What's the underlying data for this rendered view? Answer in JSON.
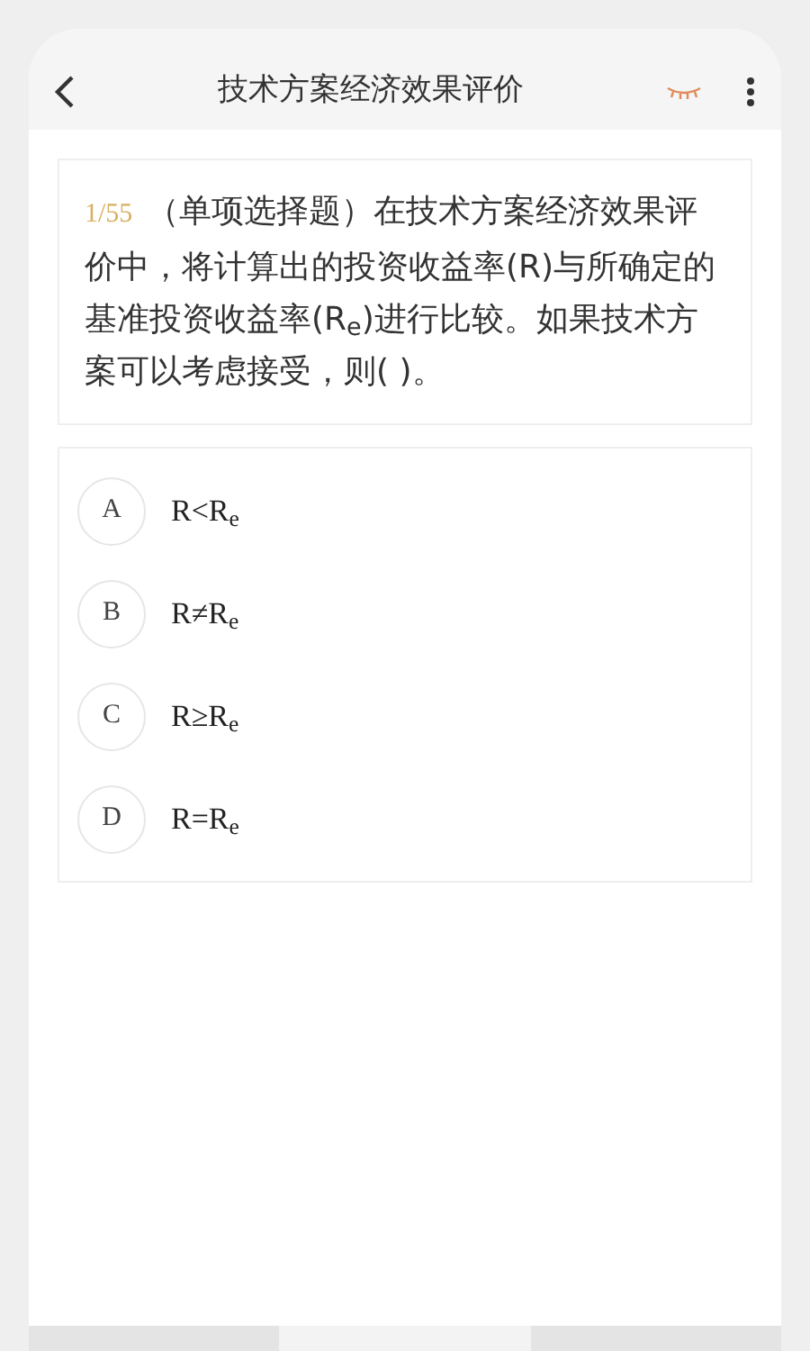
{
  "header": {
    "title": "技术方案经济效果评价"
  },
  "question": {
    "number": "1/55",
    "text": "（单项选择题）在技术方案经济效果评价中，将计算出的投资收益率(R)与所确定的基准投资收益率(R$_{e}$)进行比较。如果技术方案可以考虑接受，则( )。"
  },
  "options": [
    {
      "letter": "A",
      "text": "R<R$_{e}$",
      "selected": false
    },
    {
      "letter": "B",
      "text": "R≠R$_{e}$",
      "selected": false
    },
    {
      "letter": "C",
      "text": "R≥R$_{e}$",
      "selected": false
    },
    {
      "letter": "D",
      "text": "R=R$_{e}$",
      "selected": false
    }
  ],
  "bottom_tabs": [
    {
      "selected": false
    },
    {
      "selected": true
    },
    {
      "selected": false
    }
  ]
}
